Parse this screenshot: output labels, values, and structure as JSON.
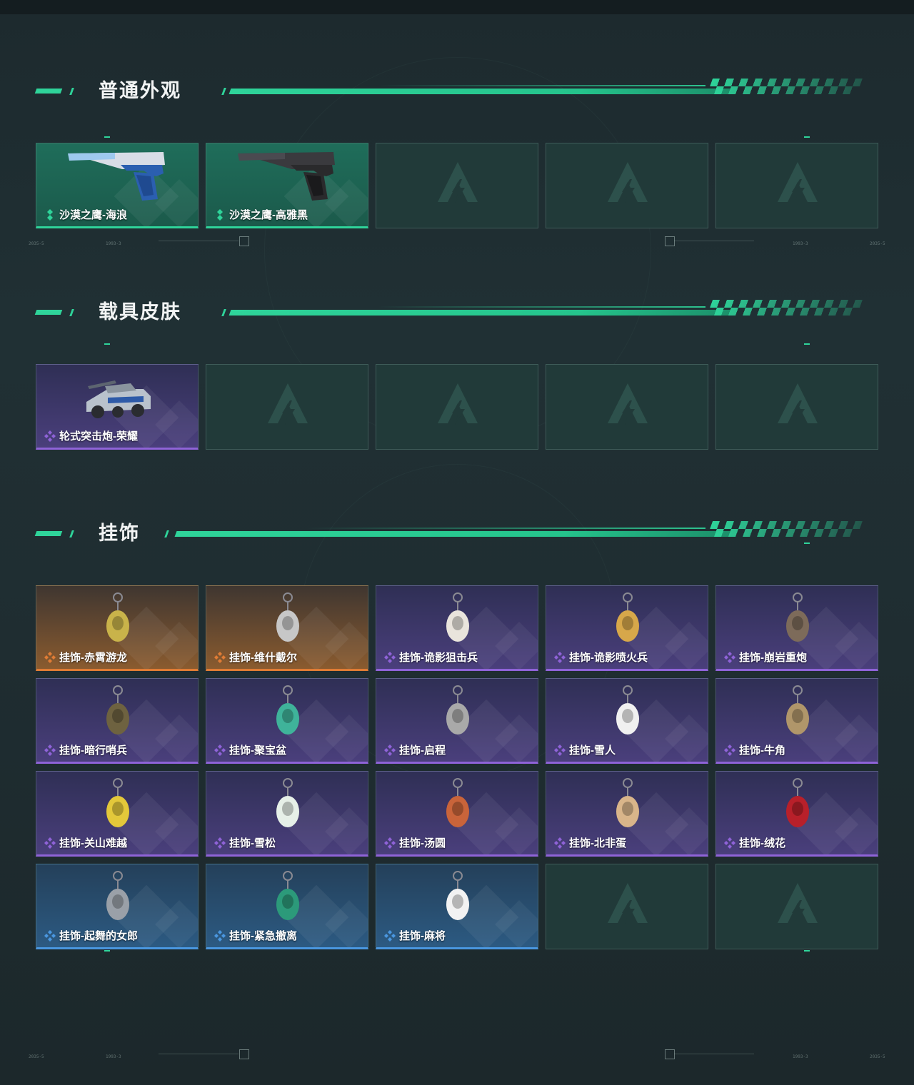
{
  "sections": [
    {
      "title": "普通外观",
      "cards": [
        {
          "name": "沙漠之鹰-海浪",
          "rarity": "green",
          "art": "pistol-blue"
        },
        {
          "name": "沙漠之鹰-高雅黑",
          "rarity": "green",
          "art": "pistol-black"
        },
        {
          "name": "",
          "rarity": "empty",
          "art": "none"
        },
        {
          "name": "",
          "rarity": "empty",
          "art": "none"
        },
        {
          "name": "",
          "rarity": "empty",
          "art": "none"
        }
      ]
    },
    {
      "title": "载具皮肤",
      "cards": [
        {
          "name": "轮式突击炮-荣耀",
          "rarity": "purple",
          "art": "vehicle"
        },
        {
          "name": "",
          "rarity": "empty",
          "art": "none"
        },
        {
          "name": "",
          "rarity": "empty",
          "art": "none"
        },
        {
          "name": "",
          "rarity": "empty",
          "art": "none"
        },
        {
          "name": "",
          "rarity": "empty",
          "art": "none"
        }
      ]
    },
    {
      "title": "挂饰",
      "cards": [
        {
          "name": "挂饰-赤霄游龙",
          "rarity": "orange",
          "art": "charm"
        },
        {
          "name": "挂饰-维什戴尔",
          "rarity": "orange",
          "art": "charm"
        },
        {
          "name": "挂饰-诡影狙击兵",
          "rarity": "purple",
          "art": "charm"
        },
        {
          "name": "挂饰-诡影喷火兵",
          "rarity": "purple",
          "art": "charm"
        },
        {
          "name": "挂饰-崩岩重炮",
          "rarity": "purple",
          "art": "charm"
        },
        {
          "name": "挂饰-暗行哨兵",
          "rarity": "purple",
          "art": "charm"
        },
        {
          "name": "挂饰-聚宝盆",
          "rarity": "purple",
          "art": "charm"
        },
        {
          "name": "挂饰-启程",
          "rarity": "purple",
          "art": "charm"
        },
        {
          "name": "挂饰-雪人",
          "rarity": "purple",
          "art": "charm"
        },
        {
          "name": "挂饰-牛角",
          "rarity": "purple",
          "art": "charm"
        },
        {
          "name": "挂饰-关山难越",
          "rarity": "purple",
          "art": "charm"
        },
        {
          "name": "挂饰-雪松",
          "rarity": "purple",
          "art": "charm"
        },
        {
          "name": "挂饰-汤圆",
          "rarity": "purple",
          "art": "charm"
        },
        {
          "name": "挂饰-北非蛋",
          "rarity": "purple",
          "art": "charm"
        },
        {
          "name": "挂饰-绒花",
          "rarity": "purple",
          "art": "charm"
        },
        {
          "name": "挂饰-起舞的女郎",
          "rarity": "blue",
          "art": "charm"
        },
        {
          "name": "挂饰-紧急撤离",
          "rarity": "blue",
          "art": "charm"
        },
        {
          "name": "挂饰-麻将",
          "rarity": "blue",
          "art": "charm"
        },
        {
          "name": "",
          "rarity": "empty",
          "art": "none"
        },
        {
          "name": "",
          "rarity": "empty",
          "art": "none"
        }
      ]
    }
  ],
  "colors": {
    "accent": "#2fd49a",
    "green": "#2fd49a",
    "purple": "#8f63d8",
    "orange": "#e07c35",
    "blue": "#4a97e0"
  },
  "deco_text": [
    "2035-5",
    "1993-3"
  ]
}
